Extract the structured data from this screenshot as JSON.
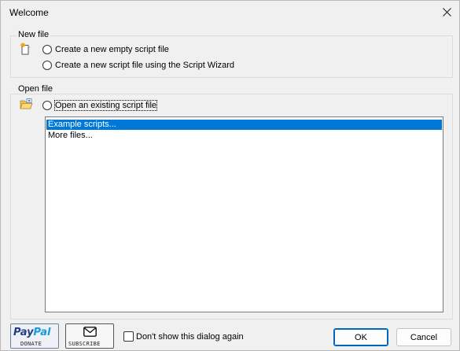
{
  "window": {
    "title": "Welcome"
  },
  "new_file": {
    "group_label": "New file",
    "option_empty": "Create a new empty script file",
    "option_wizard": "Create a new script file using the Script Wizard"
  },
  "open_file": {
    "group_label": "Open file",
    "option_existing": "Open an existing script file",
    "items": [
      "Example scripts...",
      "More files..."
    ],
    "selected_index": 0
  },
  "footer": {
    "paypal_logo_pay": "Pay",
    "paypal_logo_pal": "Pal",
    "donate_label": "DONATE",
    "subscribe_label": "SUBSCRIBE",
    "dont_show_label": "Don't show this dialog again",
    "ok_label": "OK",
    "cancel_label": "Cancel"
  },
  "colors": {
    "selection": "#0078d7",
    "ok_border": "#0067c0",
    "paypal_dark": "#253b80",
    "paypal_light": "#179bd7"
  }
}
